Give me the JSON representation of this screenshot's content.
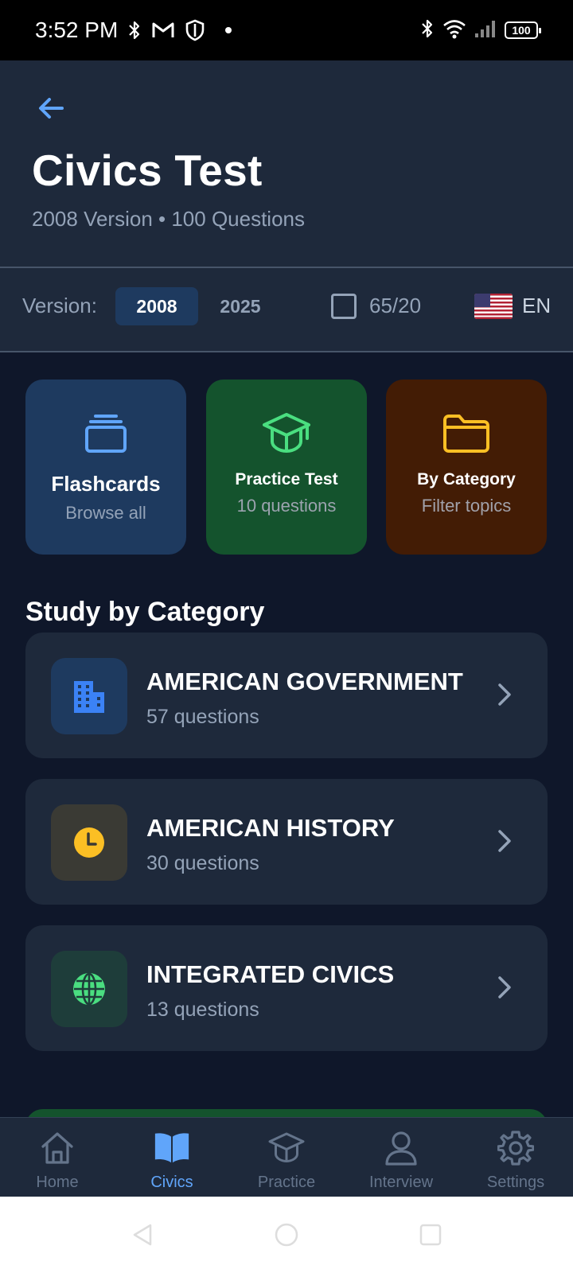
{
  "status_bar": {
    "time": "3:52 PM",
    "left_icons": [
      "bluetooth-icon",
      "gmail-icon",
      "shield-icon",
      "dot-icon"
    ],
    "right_icons": [
      "bluetooth-icon",
      "wifi-icon",
      "signal-icon"
    ],
    "battery": "100"
  },
  "header": {
    "back_icon": "arrow-left-icon",
    "title": "Civics Test",
    "subtitle": "2008 Version • 100 Questions"
  },
  "version_bar": {
    "label": "Version:",
    "options": [
      "2008",
      "2025"
    ],
    "selected": "2008",
    "checkbox_label": "65/20",
    "checkbox_checked": false,
    "language_flag": "us-flag-icon",
    "language": "EN"
  },
  "tiles": [
    {
      "title": "Flashcards",
      "subtitle": "Browse all",
      "icon": "cards-stack-icon",
      "color": "#60a5fa"
    },
    {
      "title": "Practice Test",
      "subtitle": "10 questions",
      "icon": "graduation-cap-icon",
      "color": "#4ade80"
    },
    {
      "title": "By Category",
      "subtitle": "Filter topics",
      "icon": "folder-icon",
      "color": "#fbbf24"
    }
  ],
  "section_title": "Study by Category",
  "categories": [
    {
      "name": "AMERICAN GOVERNMENT",
      "count": "57 questions",
      "icon": "building-icon",
      "color": "#3b82f6"
    },
    {
      "name": "AMERICAN HISTORY",
      "count": "30 questions",
      "icon": "clock-icon",
      "color": "#fbbf24"
    },
    {
      "name": "INTEGRATED CIVICS",
      "count": "13 questions",
      "icon": "globe-icon",
      "color": "#4ade80"
    }
  ],
  "bottom_nav": [
    {
      "label": "Home",
      "icon": "home-icon",
      "active": false
    },
    {
      "label": "Civics",
      "icon": "book-open-icon",
      "active": true
    },
    {
      "label": "Practice",
      "icon": "graduation-cap-icon",
      "active": false
    },
    {
      "label": "Interview",
      "icon": "user-icon",
      "active": false
    },
    {
      "label": "Settings",
      "icon": "gear-icon",
      "active": false
    }
  ],
  "colors": {
    "background": "#0f172a",
    "surface": "#1e293b",
    "accent": "#60a5fa",
    "muted_text": "#94a3b8"
  }
}
